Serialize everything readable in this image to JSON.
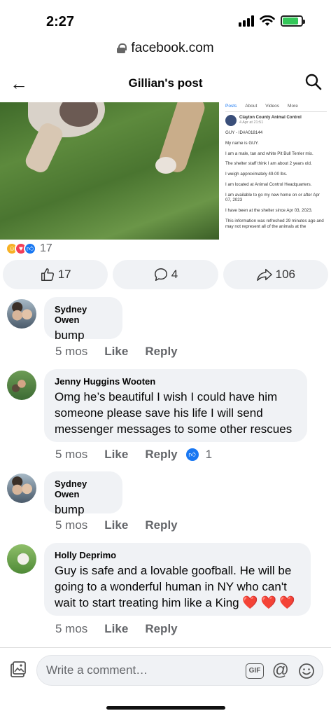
{
  "status": {
    "time": "2:27"
  },
  "browser": {
    "url": "facebook.com"
  },
  "nav": {
    "title": "Gillian's post"
  },
  "shelter_post": {
    "tabs": [
      "Posts",
      "About",
      "Videos",
      "More"
    ],
    "org": "Clayton County Animal Control",
    "date": "4 Apr at 21:51",
    "lines": [
      "GUY - ID#A018144",
      "My name is GUY.",
      "I am a male, tan and white Pit Bull Terrier mix.",
      "The shelter staff think I am about 2 years old.",
      "I weigh approximately 49.00 lbs.",
      "I am located at Animal Control Headquarters.",
      "I am available to go my new home on or after Apr 07, 2023",
      "I have been at the shelter since Apr 03, 2023.",
      "This information was refreshed 29 minutes ago and may not represent all of the animals at the"
    ]
  },
  "reactions": {
    "count": "17",
    "types": [
      "haha",
      "love",
      "like"
    ]
  },
  "actions": {
    "like_count": "17",
    "comment_count": "4",
    "share_count": "106"
  },
  "comments": [
    {
      "name": "Sydney Owen",
      "text": "bump",
      "time": "5 mos",
      "like": "Like",
      "reply": "Reply"
    },
    {
      "name": "Jenny Huggins Wooten",
      "lines": [
        "Omg he’s beautiful I wish I could have him",
        "someone please save his life I will send",
        "messenger messages to some other rescues"
      ],
      "time": "5 mos",
      "like": "Like",
      "reply": "Reply",
      "likes": "1"
    },
    {
      "name": "Sydney Owen",
      "text": "bump",
      "time": "5 mos",
      "like": "Like",
      "reply": "Reply"
    },
    {
      "name": "Holly Deprimo",
      "lines": [
        "Guy is safe and a lovable goofball. He will be",
        "going to a wonderful human in NY who can't",
        "wait to start treating him like a King"
      ],
      "hearts": "❤️❤️❤️",
      "time": "5 mos",
      "like": "Like",
      "reply": "Reply"
    }
  ],
  "composer": {
    "placeholder": "Write a comment…",
    "gif": "GIF",
    "at": "@"
  },
  "colors": {
    "accent": "#1877f2",
    "bubble": "#f0f2f5",
    "muted": "#65676b",
    "heart": "#e0242b"
  },
  "icons": [
    "back-arrow-icon",
    "search-icon",
    "lock-icon",
    "thumbs-up-icon",
    "comment-icon",
    "share-icon",
    "photo-icon",
    "gif-icon",
    "mention-icon",
    "emoji-icon"
  ]
}
